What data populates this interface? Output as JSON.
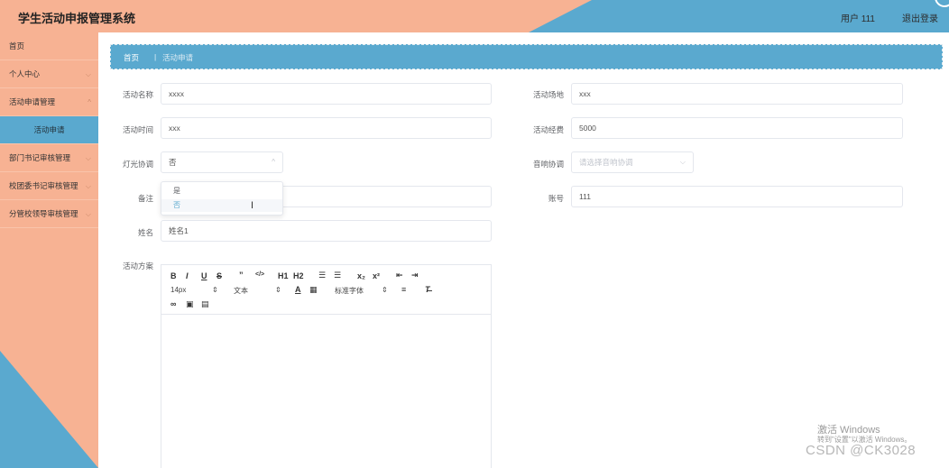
{
  "header": {
    "title": "学生活动申报管理系统",
    "user": "用户 111",
    "logout": "退出登录"
  },
  "sidebar": {
    "items": [
      {
        "label": "首页"
      },
      {
        "label": "个人中心"
      },
      {
        "label": "活动申请管理"
      },
      {
        "label": "活动申请"
      },
      {
        "label": "部门书记审核管理"
      },
      {
        "label": "校团委书记审核管理"
      },
      {
        "label": "分管校领导审核管理"
      }
    ]
  },
  "breadcrumb": {
    "home": "首页",
    "sep": "|",
    "current": "活动申请"
  },
  "form": {
    "name_label": "活动名称",
    "name_value": "xxxx",
    "place_label": "活动场地",
    "place_value": "xxx",
    "time_label": "活动时间",
    "time_value": "xxx",
    "budget_label": "活动经费",
    "budget_value": "5000",
    "light_label": "灯光协调",
    "light_value": "否",
    "sound_label": "音响协调",
    "sound_placeholder": "请选择音响协调",
    "remark_label": "备注",
    "account_label": "账号",
    "account_value": "111",
    "person_label": "姓名",
    "person_value": "姓名1",
    "plan_label": "活动方案"
  },
  "dropdown": {
    "options": [
      "是",
      "否"
    ],
    "selected": "否"
  },
  "editor": {
    "font_size": "14px",
    "paragraph": "文本",
    "font_family": "标准字体",
    "buttons": [
      "B",
      "I",
      "U",
      "S",
      "”",
      "</>",
      "H1",
      "H2",
      "x₂",
      "x²",
      "A"
    ]
  },
  "overlay": {
    "win_activate": "激活 Windows",
    "win_hint": "转到\"设置\"以激活 Windows。",
    "csdn": "CSDN @CK3028"
  }
}
